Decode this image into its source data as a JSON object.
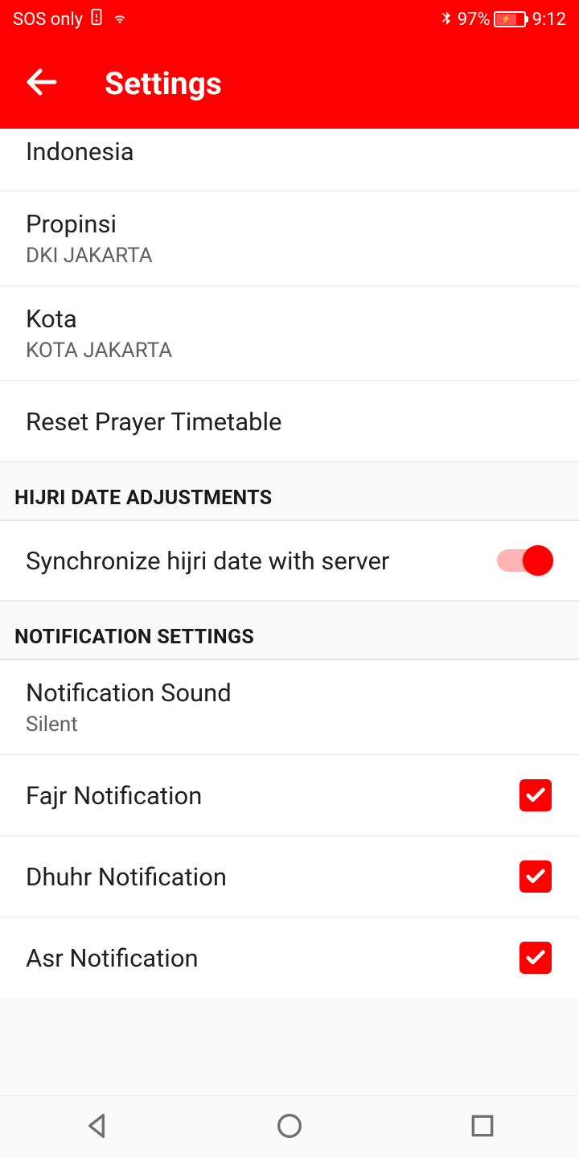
{
  "status": {
    "left_text": "SOS only",
    "bluetooth": "97%",
    "time": "9:12"
  },
  "header": {
    "title": "Settings"
  },
  "items": {
    "country_value": "Indonesia",
    "province_label": "Propinsi",
    "province_value": "DKI JAKARTA",
    "city_label": "Kota",
    "city_value": "KOTA JAKARTA",
    "reset_label": "Reset Prayer Timetable"
  },
  "sections": {
    "hijri": "HIJRI DATE ADJUSTMENTS",
    "notif": "NOTIFICATION SETTINGS"
  },
  "hijri_sync": {
    "label": "Synchronize hijri date with server",
    "enabled": true
  },
  "notif_sound": {
    "label": "Notification Sound",
    "value": "Silent"
  },
  "notifications": {
    "fajr": {
      "label": "Fajr Notification",
      "checked": true
    },
    "dhuhr": {
      "label": "Dhuhr Notification",
      "checked": true
    },
    "asr": {
      "label": "Asr Notification",
      "checked": true
    }
  }
}
